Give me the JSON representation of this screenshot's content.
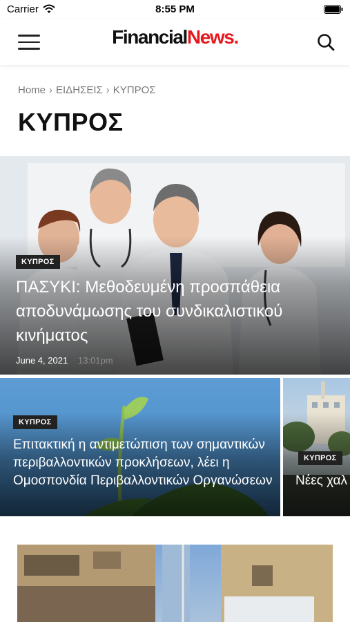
{
  "status_bar": {
    "carrier": "Carrier",
    "time": "8:55 PM"
  },
  "header": {
    "logo_part1": "Financial",
    "logo_part2": "News.",
    "brand_color": "#e5191e"
  },
  "breadcrumb": {
    "home": "Home",
    "news": "ΕΙΔΗΣΕΙΣ",
    "current": "ΚΥΠΡΟΣ",
    "separator": "›"
  },
  "page": {
    "title": "ΚΥΠΡΟΣ"
  },
  "featured": {
    "category": "ΚΥΠΡΟΣ",
    "title": "ΠΑΣΥΚΙ: Μεθοδευμένη προσπάθεια αποδυνάμωσης του συνδικαλιστικού κινήματος",
    "date": "June 4, 2021",
    "time": "13:01pm"
  },
  "cards": [
    {
      "category": "ΚΥΠΡΟΣ",
      "title": "Επιτακτική η αντιμετώπιση των σημαντικών περιβαλλοντικών προκλήσεων, λέει η Ομοσπονδία Περιβαλλοντικών Οργανώσεων"
    },
    {
      "category": "ΚΥΠΡΟΣ",
      "title": "Νέες χαλ μέτρα απ"
    }
  ]
}
